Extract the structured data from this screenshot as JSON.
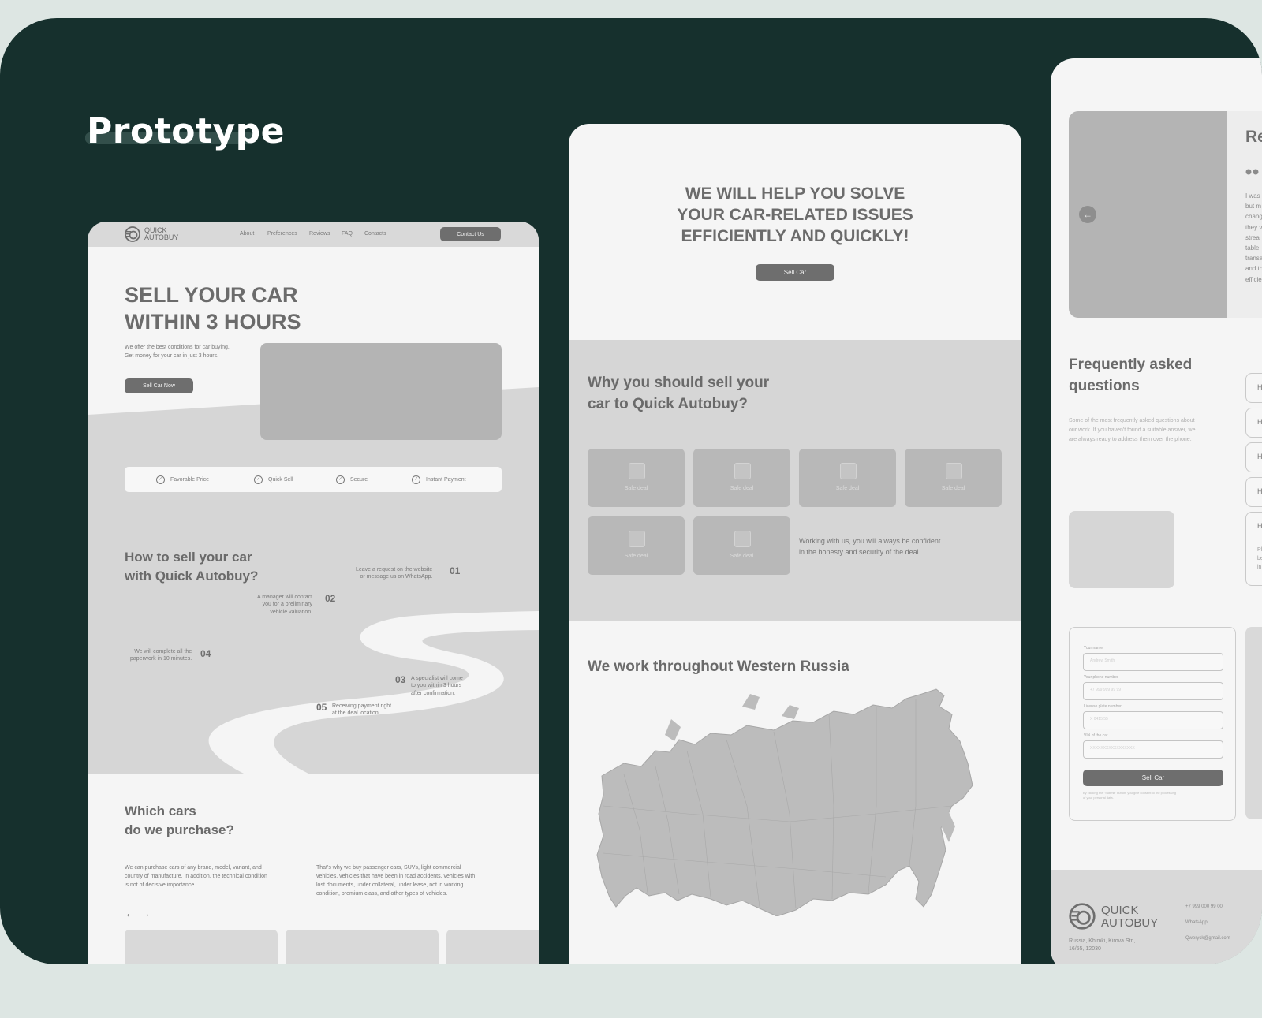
{
  "heading": "Prototype",
  "landing": {
    "logo": {
      "line1": "QUICK",
      "line2": "AUTOBUY"
    },
    "nav": [
      "About",
      "Preferences",
      "Reviews",
      "FAQ",
      "Contacts"
    ],
    "contact_button": "Contact Us",
    "hero": {
      "title_line1": "SELL YOUR CAR",
      "title_line2": "WITHIN 3 HOURS",
      "subtitle_line1": "We offer the best conditions for car buying.",
      "subtitle_line2": "Get money for your car in just 3 hours.",
      "cta": "Sell Car Now"
    },
    "features": [
      "Favorable Price",
      "Quick Sell",
      "Secure",
      "Instant Payment"
    ],
    "how": {
      "title_line1": "How to sell your car",
      "title_line2": "with Quick Autobuy?",
      "steps": [
        {
          "num": "01",
          "line1": "Leave a request on the website",
          "line2": "or message us on WhatsApp."
        },
        {
          "num": "02",
          "line1": "A manager will contact",
          "line2": "you for a preliminary",
          "line3": "vehicle valuation."
        },
        {
          "num": "03",
          "line1": "A specialist will come",
          "line2": "to you within 3 hours",
          "line3": "after confirmation."
        },
        {
          "num": "04",
          "line1": "We will complete all the",
          "line2": "paperwork in 10 minutes."
        },
        {
          "num": "05",
          "line1": "Receiving payment right",
          "line2": "at the deal location."
        }
      ]
    },
    "which": {
      "title_line1": "Which cars",
      "title_line2": "do we purchase?",
      "col1": [
        "We can purchase cars of any brand, model, variant, and",
        "country of manufacture. In addition, the technical condition",
        "is not of decisive importance."
      ],
      "col2": [
        "That's why we buy passenger cars, SUVs, light commercial",
        "vehicles, vehicles that have been in road accidents, vehicles with",
        "lost documents, under collateral, under lease, not in working",
        "condition, premium class, and other types of vehicles."
      ],
      "arrow_prev": "←",
      "arrow_next": "→"
    }
  },
  "middle": {
    "hero_line1": "WE WILL HELP YOU SOLVE",
    "hero_line2": "YOUR CAR-RELATED ISSUES",
    "hero_line3": "EFFICIENTLY AND QUICKLY!",
    "cta": "Sell Car",
    "why_line1": "Why you should sell your",
    "why_line2": "car to Quick Autobuy?",
    "card_label": "Safe deal",
    "note_line1": "Working with us, you will always be confident",
    "note_line2": "in the honesty and security of the deal.",
    "region_title": "We work throughout Western Russia"
  },
  "right": {
    "review_title_partial": "Re",
    "review_text": [
      "I was",
      "but m",
      "chang",
      "they v",
      "strea",
      "table.",
      "transa",
      "and th",
      "efficie"
    ],
    "faq_title_line1": "Frequently asked",
    "faq_title_line2": "questions",
    "faq_desc": [
      "Some of the most frequently asked questions about",
      "our work. If you haven't found a suitable answer, we",
      "are always ready to address them over the phone."
    ],
    "faq_item_letter": "H",
    "faq_open_text": [
      "Pl",
      "be",
      "in"
    ],
    "form": {
      "fields": [
        {
          "label": "Your name",
          "placeholder": "Andrew Smith"
        },
        {
          "label": "Your phone number",
          "placeholder": "+7 999 999 99 99"
        },
        {
          "label": "License plate number",
          "placeholder": "X 0415 55"
        },
        {
          "label": "VIN of the car",
          "placeholder": "XXXXXXXXXXXXXXXXX"
        }
      ],
      "submit": "Sell Car",
      "consent_line1": "By clicking the \"Submit\" button, you give consent to the processing",
      "consent_line2": "of your personal data."
    },
    "footer": {
      "logo_line1": "QUICK",
      "logo_line2": "AUTOBUY",
      "address_line1": "Russia, Khimki, Kirova Str.,",
      "address_line2": "16/55, 12030",
      "phone": "+7 999 000 99 00",
      "whatsapp": "WhatsApp",
      "email": "Qweryck@gmail.com"
    }
  },
  "colors": {
    "board": "#16302d",
    "outer_bg": "#dde6e3",
    "frame_bg": "#f5f5f5",
    "section_gray": "#d6d6d6",
    "placeholder": "#b4b4b4",
    "text_dark": "#6f6f6f"
  }
}
